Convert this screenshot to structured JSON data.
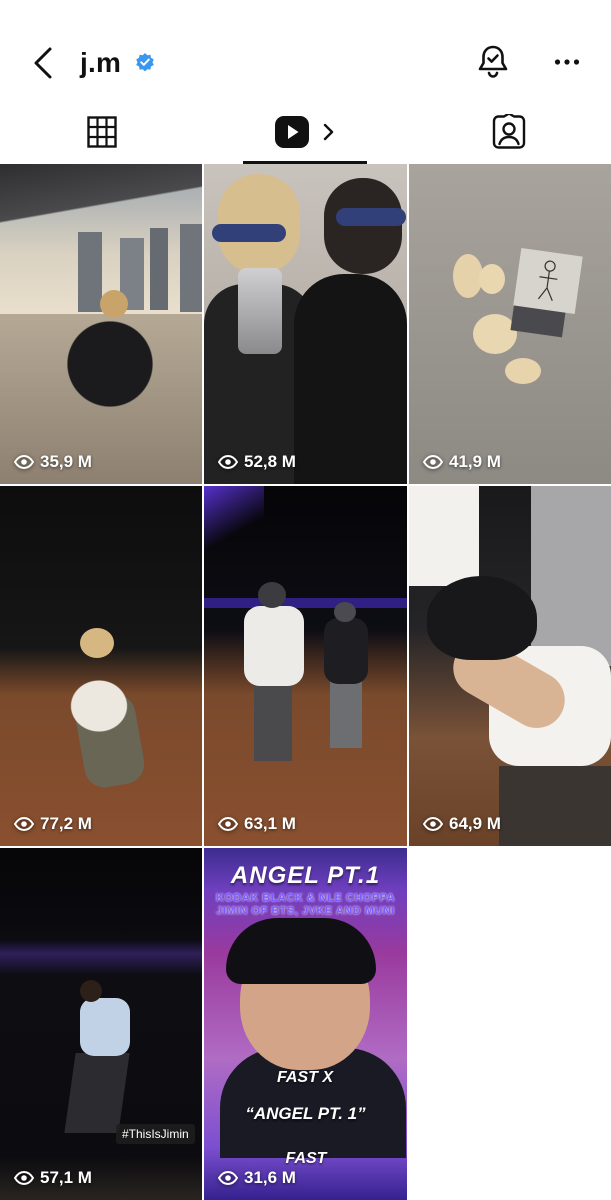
{
  "header": {
    "username": "j.m",
    "verified": true,
    "icons": [
      "back-icon",
      "verified-badge-icon",
      "notification-bell-icon",
      "more-icon"
    ]
  },
  "tabs": [
    {
      "name": "grid",
      "icon": "grid-icon",
      "active": false
    },
    {
      "name": "reels",
      "icon": "reels-icon",
      "active": true
    },
    {
      "name": "tagged",
      "icon": "tagged-icon",
      "active": false
    }
  ],
  "reels": [
    {
      "views": "35,9 M"
    },
    {
      "views": "52,8 M"
    },
    {
      "views": "41,9 M"
    },
    {
      "views": "77,2 M"
    },
    {
      "views": "63,1 M"
    },
    {
      "views": "64,9 M"
    },
    {
      "views": "57,1 M",
      "overlay_tag": "#ThisIsJimin"
    },
    {
      "views": "31,6 M",
      "poster": {
        "title": "ANGEL PT.1",
        "credits": "KODAK BLACK & NLE CHOPPA JIMIN OF BTS, JVKE AND MUNI LONG",
        "logo": "FAST X",
        "subtitle": "“ANGEL PT. 1”",
        "logo_bottom": "FAST"
      }
    }
  ],
  "colors": {
    "accent_verified": "#3897f0",
    "text": "#111111",
    "background": "#ffffff"
  }
}
